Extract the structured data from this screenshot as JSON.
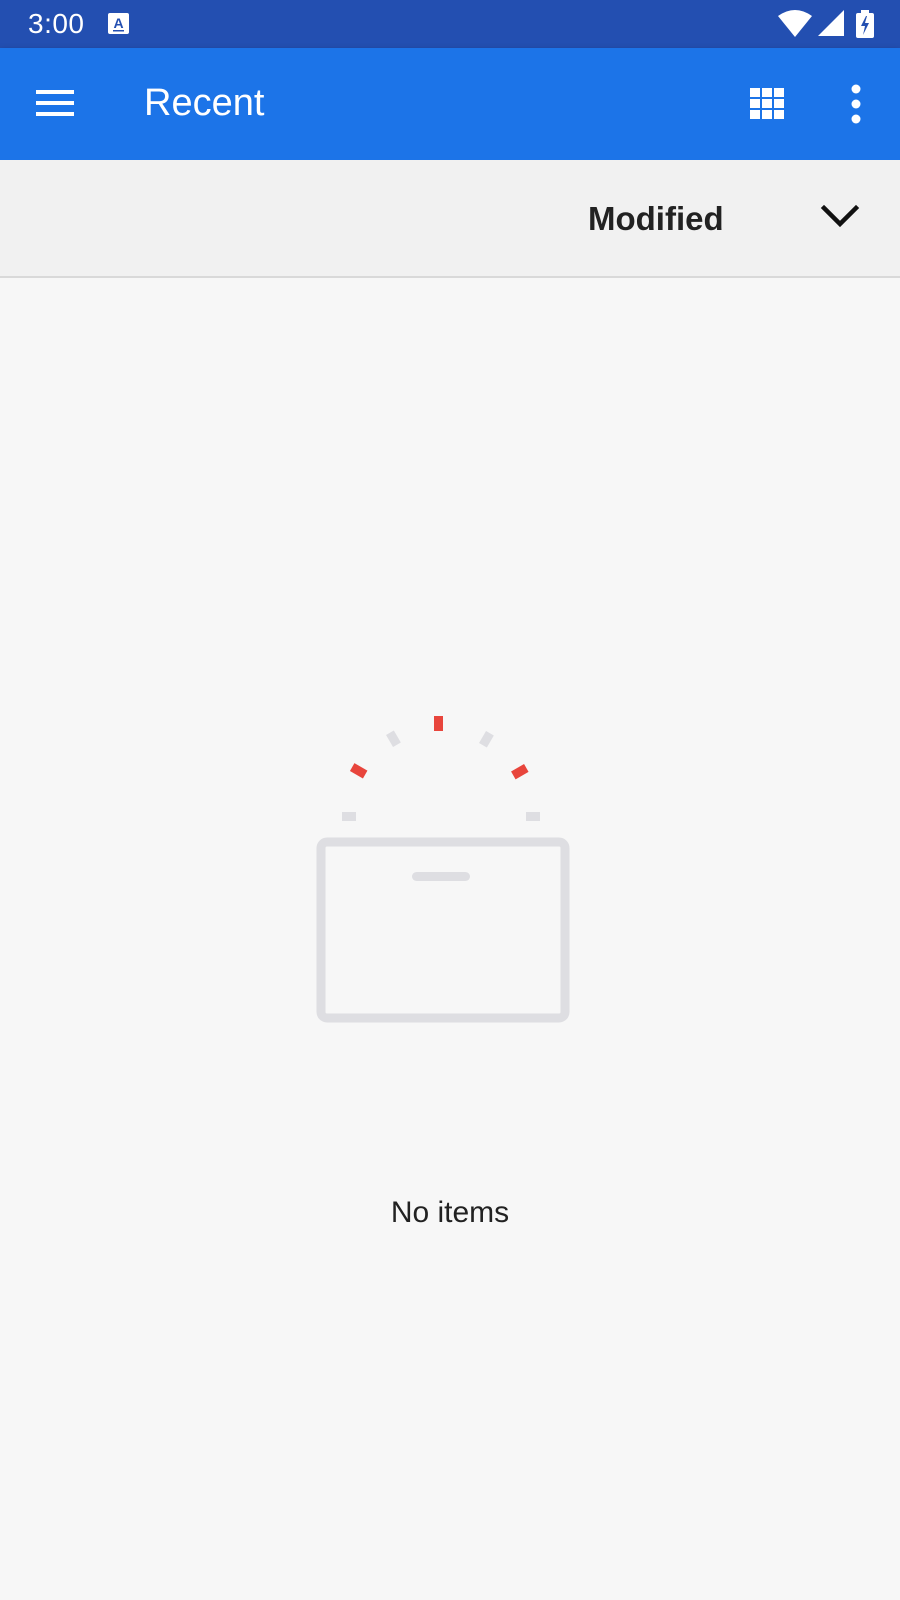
{
  "status_bar": {
    "time": "3:00",
    "icons": [
      "accessibility-a-icon",
      "wifi-icon",
      "signal-icon",
      "battery-charging-icon"
    ]
  },
  "app_bar": {
    "title": "Recent",
    "color": "#1c74e8",
    "icons": [
      "menu-icon",
      "grid-view-icon",
      "more-vert-icon"
    ]
  },
  "sort": {
    "label": "Modified",
    "icon": "chevron-down-icon"
  },
  "empty_state": {
    "message": "No items",
    "illustration": "empty-box-icon",
    "accent_color": "#e8453c"
  }
}
